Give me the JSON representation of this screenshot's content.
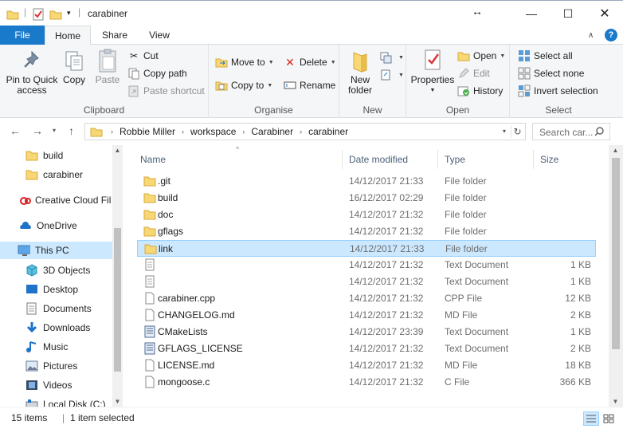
{
  "window": {
    "title": "carabiner"
  },
  "tabs": {
    "file": "File",
    "home": "Home",
    "share": "Share",
    "view": "View"
  },
  "ribbon": {
    "clipboard": {
      "label": "Clipboard",
      "pin": "Pin to Quick access",
      "copy": "Copy",
      "paste": "Paste",
      "cut": "Cut",
      "copy_path": "Copy path",
      "paste_shortcut": "Paste shortcut"
    },
    "organise": {
      "label": "Organise",
      "move_to": "Move to",
      "copy_to": "Copy to",
      "delete": "Delete",
      "rename": "Rename"
    },
    "new": {
      "label": "New",
      "new_folder": "New folder"
    },
    "open": {
      "label": "Open",
      "properties": "Properties",
      "open": "Open",
      "edit": "Edit",
      "history": "History"
    },
    "select": {
      "label": "Select",
      "select_all": "Select all",
      "select_none": "Select none",
      "invert": "Invert selection"
    }
  },
  "address": {
    "crumbs": [
      "Robbie Miller",
      "workspace",
      "Carabiner",
      "carabiner"
    ],
    "search_placeholder": "Search car..."
  },
  "nav": {
    "items": [
      {
        "label": "build",
        "icon": "folder-icon"
      },
      {
        "label": "carabiner",
        "icon": "folder-icon"
      },
      {
        "label": "Creative Cloud Fil",
        "icon": "creative-cloud-icon"
      },
      {
        "label": "OneDrive",
        "icon": "onedrive-icon"
      },
      {
        "label": "This PC",
        "icon": "computer-icon"
      },
      {
        "label": "3D Objects",
        "icon": "3d-objects-icon"
      },
      {
        "label": "Desktop",
        "icon": "desktop-icon"
      },
      {
        "label": "Documents",
        "icon": "documents-icon"
      },
      {
        "label": "Downloads",
        "icon": "downloads-icon"
      },
      {
        "label": "Music",
        "icon": "music-icon"
      },
      {
        "label": "Pictures",
        "icon": "pictures-icon"
      },
      {
        "label": "Videos",
        "icon": "videos-icon"
      },
      {
        "label": "Local Disk (C:)",
        "icon": "drive-icon"
      }
    ]
  },
  "columns": {
    "name": "Name",
    "date": "Date modified",
    "type": "Type",
    "size": "Size"
  },
  "files": [
    {
      "name": ".git",
      "date": "14/12/2017 21:33",
      "type": "File folder",
      "size": "",
      "icon": "folder"
    },
    {
      "name": "build",
      "date": "16/12/2017 02:29",
      "type": "File folder",
      "size": "",
      "icon": "folder"
    },
    {
      "name": "doc",
      "date": "14/12/2017 21:32",
      "type": "File folder",
      "size": "",
      "icon": "folder"
    },
    {
      "name": "gflags",
      "date": "14/12/2017 21:32",
      "type": "File folder",
      "size": "",
      "icon": "folder"
    },
    {
      "name": "link",
      "date": "14/12/2017 21:33",
      "type": "File folder",
      "size": "",
      "icon": "folder"
    },
    {
      "name": "",
      "date": "14/12/2017 21:32",
      "type": "Text Document",
      "size": "1 KB",
      "icon": "text"
    },
    {
      "name": "",
      "date": "14/12/2017 21:32",
      "type": "Text Document",
      "size": "1 KB",
      "icon": "text"
    },
    {
      "name": "carabiner.cpp",
      "date": "14/12/2017 21:32",
      "type": "CPP File",
      "size": "12 KB",
      "icon": "file"
    },
    {
      "name": "CHANGELOG.md",
      "date": "14/12/2017 21:32",
      "type": "MD File",
      "size": "2 KB",
      "icon": "file"
    },
    {
      "name": "CMakeLists",
      "date": "14/12/2017 23:39",
      "type": "Text Document",
      "size": "1 KB",
      "icon": "doc"
    },
    {
      "name": "GFLAGS_LICENSE",
      "date": "14/12/2017 21:32",
      "type": "Text Document",
      "size": "2 KB",
      "icon": "doc"
    },
    {
      "name": "LICENSE.md",
      "date": "14/12/2017 21:32",
      "type": "MD File",
      "size": "18 KB",
      "icon": "file"
    },
    {
      "name": "mongoose.c",
      "date": "14/12/2017 21:32",
      "type": "C File",
      "size": "366 KB",
      "icon": "file"
    }
  ],
  "status": {
    "count": "15 items",
    "selected": "1 item selected"
  },
  "colors": {
    "accent": "#1979ca",
    "selection": "#cce8ff",
    "folder": "#f8d775"
  }
}
